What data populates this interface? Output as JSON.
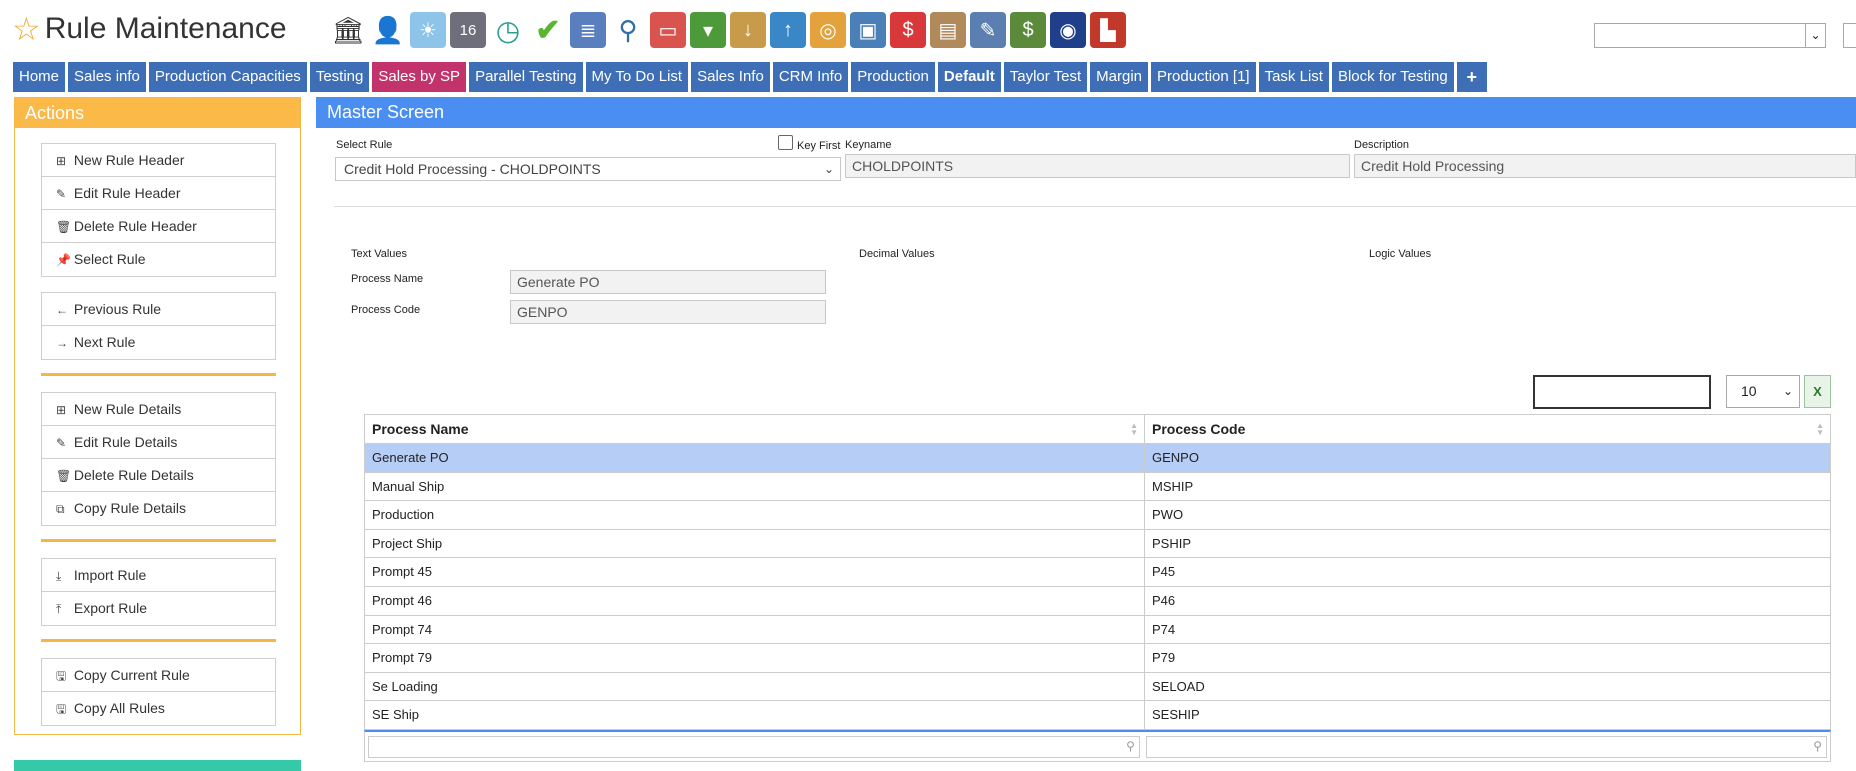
{
  "app": {
    "title": "Rule Maintenance"
  },
  "toolbar_icons": [
    "bank-icon",
    "user-icon",
    "weather-icon",
    "calendar-icon",
    "clock-icon",
    "checkmark-icon",
    "list-icon",
    "magnifier-icon",
    "truck-icon",
    "basket-icon",
    "inbox-download-icon",
    "box-upload-icon",
    "coins-icon",
    "monitor-icon",
    "dollar-chat-icon",
    "clipboard-icon",
    "pencil-icon",
    "money-icon",
    "passport-icon",
    "factory-icon"
  ],
  "toolbar": {
    "calendar_day": "16"
  },
  "tabs": [
    {
      "label": "Home"
    },
    {
      "label": "Sales info"
    },
    {
      "label": "Production Capacities"
    },
    {
      "label": "Testing"
    },
    {
      "label": "Sales by SP"
    },
    {
      "label": "Parallel Testing"
    },
    {
      "label": "My To Do List"
    },
    {
      "label": "Sales Info"
    },
    {
      "label": "CRM Info"
    },
    {
      "label": "Production"
    },
    {
      "label": "Default"
    },
    {
      "label": "Taylor Test"
    },
    {
      "label": "Margin"
    },
    {
      "label": "Production [1]"
    },
    {
      "label": "Task List"
    },
    {
      "label": "Block for Testing"
    },
    {
      "label": "+"
    }
  ],
  "actions": {
    "title": "Actions",
    "group1": [
      "New Rule Header",
      "Edit Rule Header",
      "Delete Rule Header",
      "Select Rule"
    ],
    "group2": [
      "Previous Rule",
      "Next Rule"
    ],
    "group3": [
      "New Rule Details",
      "Edit Rule Details",
      "Delete Rule Details",
      "Copy Rule Details"
    ],
    "group4": [
      "Import Rule",
      "Export Rule"
    ],
    "group5": [
      "Copy Current Rule",
      "Copy All Rules"
    ]
  },
  "master": {
    "title": "Master Screen",
    "select_rule_label": "Select Rule",
    "select_rule_value": "Credit Hold Processing - CHOLDPOINTS",
    "key_first_label": "Key First",
    "keyname_label": "Keyname",
    "keyname_value": "CHOLDPOINTS",
    "description_label": "Description",
    "description_value": "Credit Hold Processing",
    "text_values_label": "Text Values",
    "decimal_values_label": "Decimal Values",
    "logic_values_label": "Logic Values",
    "process_name_label": "Process Name",
    "process_name_value": "Generate PO",
    "process_code_label": "Process Code",
    "process_code_value": "GENPO"
  },
  "table": {
    "page_size": "10",
    "columns": [
      "Process Name",
      "Process Code"
    ],
    "rows": [
      [
        "Generate PO",
        "GENPO"
      ],
      [
        "Manual Ship",
        "MSHIP"
      ],
      [
        "Production",
        "PWO"
      ],
      [
        "Project Ship",
        "PSHIP"
      ],
      [
        "Prompt 45",
        "P45"
      ],
      [
        "Prompt 46",
        "P46"
      ],
      [
        "Prompt 74",
        "P74"
      ],
      [
        "Prompt 79",
        "P79"
      ],
      [
        "Se Loading",
        "SELOAD"
      ],
      [
        "SE Ship",
        "SESHIP"
      ]
    ]
  }
}
